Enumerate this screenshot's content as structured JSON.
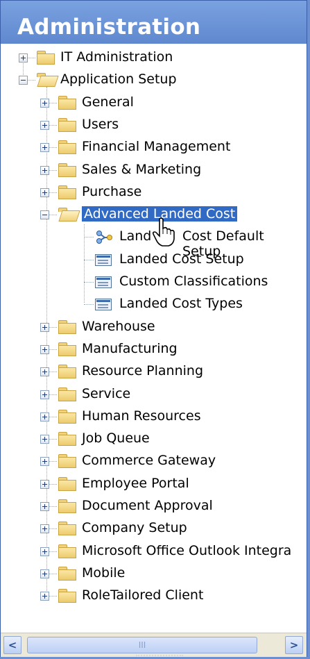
{
  "panel": {
    "title": "Administration"
  },
  "tree": {
    "items": [
      {
        "label": "IT Administration",
        "type": "folder",
        "expanded": false,
        "level": 0
      },
      {
        "label": "Application Setup",
        "type": "folder",
        "expanded": true,
        "level": 0
      },
      {
        "label": "General",
        "type": "folder",
        "expanded": false,
        "level": 1
      },
      {
        "label": "Users",
        "type": "folder",
        "expanded": false,
        "level": 1
      },
      {
        "label": "Financial Management",
        "type": "folder",
        "expanded": false,
        "level": 1
      },
      {
        "label": "Sales & Marketing",
        "type": "folder",
        "expanded": false,
        "level": 1
      },
      {
        "label": "Purchase",
        "type": "folder",
        "expanded": false,
        "level": 1
      },
      {
        "label": "Advanced Landed Cost",
        "type": "folder",
        "expanded": true,
        "selected": true,
        "level": 1
      },
      {
        "label": "Land",
        "label_rest": "Cost Default Setup",
        "type": "setup",
        "level": 2
      },
      {
        "label": "Landed Cost Setup",
        "type": "form",
        "level": 2
      },
      {
        "label": "Custom Classifications",
        "type": "form",
        "level": 2
      },
      {
        "label": "Landed Cost Types",
        "type": "form",
        "level": 2
      },
      {
        "label": "Warehouse",
        "type": "folder",
        "expanded": false,
        "level": 1
      },
      {
        "label": "Manufacturing",
        "type": "folder",
        "expanded": false,
        "level": 1
      },
      {
        "label": "Resource Planning",
        "type": "folder",
        "expanded": false,
        "level": 1
      },
      {
        "label": "Service",
        "type": "folder",
        "expanded": false,
        "level": 1
      },
      {
        "label": "Human Resources",
        "type": "folder",
        "expanded": false,
        "level": 1
      },
      {
        "label": "Job Queue",
        "type": "folder",
        "expanded": false,
        "level": 1
      },
      {
        "label": "Commerce Gateway",
        "type": "folder",
        "expanded": false,
        "level": 1
      },
      {
        "label": "Employee Portal",
        "type": "folder",
        "expanded": false,
        "level": 1
      },
      {
        "label": "Document Approval",
        "type": "folder",
        "expanded": false,
        "level": 1
      },
      {
        "label": "Company Setup",
        "type": "folder",
        "expanded": false,
        "level": 1
      },
      {
        "label": "Microsoft Office Outlook Integra",
        "type": "folder",
        "expanded": false,
        "level": 1
      },
      {
        "label": "Mobile",
        "type": "folder",
        "expanded": false,
        "level": 1
      },
      {
        "label": "RoleTailored Client",
        "type": "folder",
        "expanded": false,
        "level": 1
      }
    ]
  },
  "scrollbar": {
    "left_arrow": "<",
    "right_arrow": ">",
    "thumb_grip": "III"
  },
  "colors": {
    "header": "#6b94d8",
    "selection": "#316ac5",
    "folder": "#f0d27c"
  },
  "icons": {
    "folder": "folder-icon",
    "form": "form-icon",
    "setup": "setup-icon",
    "expander": "tree-expander-icon",
    "cursor": "hand-cursor-icon"
  }
}
